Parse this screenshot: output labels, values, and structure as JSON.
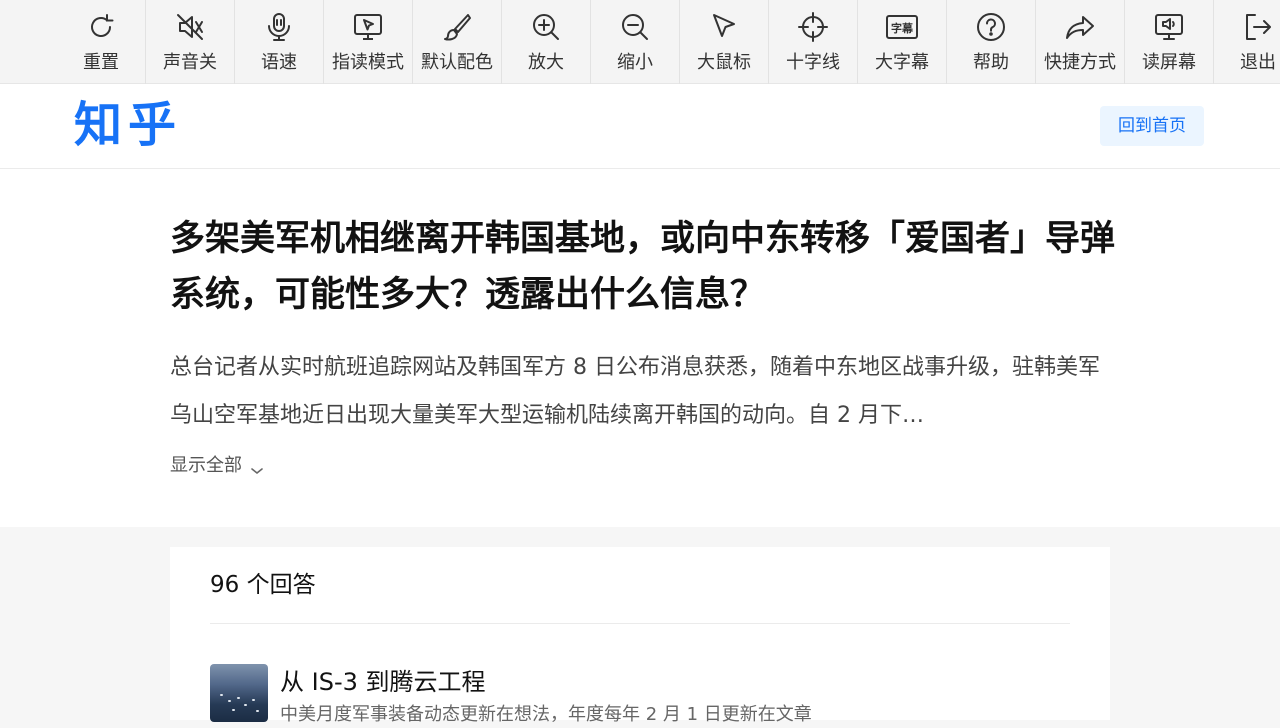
{
  "toolbar": {
    "items": [
      {
        "label": "重置",
        "icon": "reset-icon"
      },
      {
        "label": "声音关",
        "icon": "sound-off-icon"
      },
      {
        "label": "语速",
        "icon": "speech-speed-icon"
      },
      {
        "label": "指读模式",
        "icon": "point-read-icon"
      },
      {
        "label": "默认配色",
        "icon": "brush-icon"
      },
      {
        "label": "放大",
        "icon": "zoom-in-icon"
      },
      {
        "label": "缩小",
        "icon": "zoom-out-icon"
      },
      {
        "label": "大鼠标",
        "icon": "cursor-icon"
      },
      {
        "label": "十字线",
        "icon": "crosshair-icon"
      },
      {
        "label": "大字幕",
        "icon": "caption-icon"
      },
      {
        "label": "帮助",
        "icon": "help-icon"
      },
      {
        "label": "快捷方式",
        "icon": "shortcut-icon"
      },
      {
        "label": "读屏幕",
        "icon": "screen-reader-icon"
      },
      {
        "label": "退出",
        "icon": "exit-icon"
      }
    ],
    "caption_glyph": "字幕"
  },
  "header": {
    "logo": "知乎",
    "home_button": "回到首页"
  },
  "question": {
    "title": "多架美军机相继离开韩国基地，或向中东转移「爱国者」导弹系统，可能性多大？透露出什么信息？",
    "excerpt": "总台记者从实时航班追踪网站及韩国军方 8 日公布消息获悉，随着中东地区战事升级，驻韩美军乌山空军基地近日出现大量美军大型运输机陆续离开韩国的动向。自 2 月下…",
    "show_all": "显示全部"
  },
  "answers": {
    "count_label": "96 个回答",
    "first": {
      "author": "从 IS-3 到腾云工程",
      "bio": "中美月度军事装备动态更新在想法，年度每年 2 月 1 日更新在文章"
    }
  },
  "colors": {
    "brand": "#1772f6",
    "home_button_bg": "#ebf5ff",
    "toolbar_bg": "#f4f4f4"
  }
}
